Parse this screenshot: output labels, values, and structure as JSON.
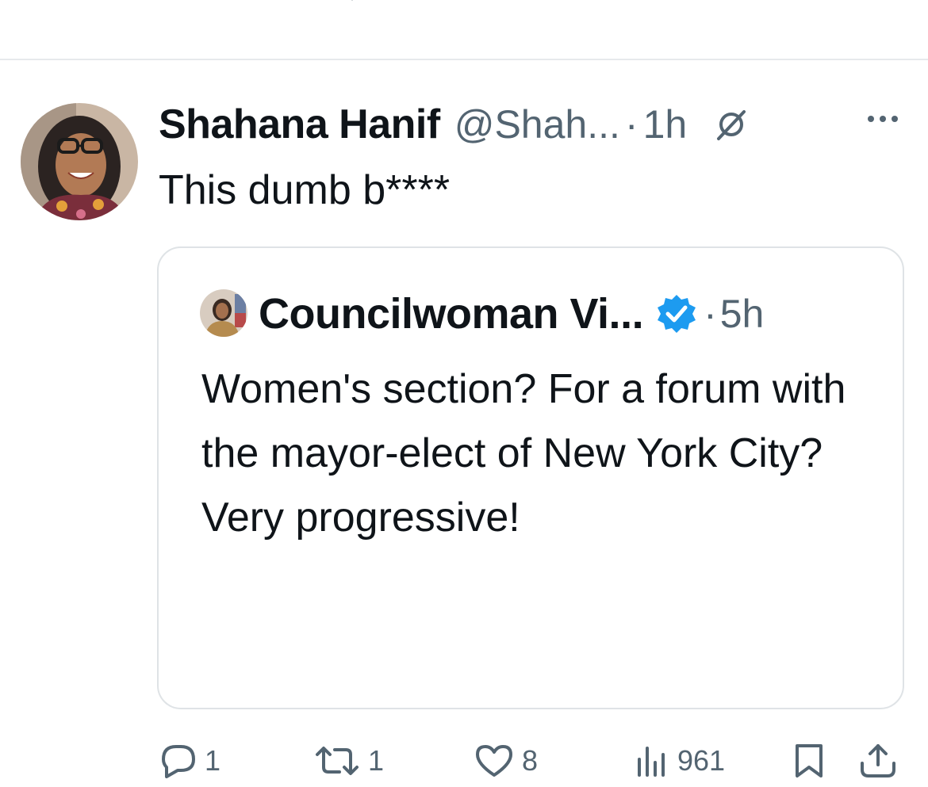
{
  "previous_tweet": {
    "note": ""
  },
  "tweet": {
    "author_name": "Shahana Hanif",
    "handle": "@Shah...",
    "separator": "·",
    "time": "1h",
    "text": "This dumb b****",
    "quote": {
      "author_name": "Councilwoman Vi...",
      "separator": "·",
      "time": "5h",
      "text": "Women's section? For a forum with the mayor-elect of New York City? Very progressive!"
    },
    "actions": {
      "replies": "1",
      "reposts": "1",
      "likes": "8",
      "views": "961"
    }
  },
  "colors": {
    "secondary_text": "#536471",
    "primary_text": "#0f1419",
    "verified_blue": "#1d9bf0",
    "border": "#dfe3e6"
  },
  "icons": {
    "grok": "slashed-circle-icon",
    "more": "more-dots-icon",
    "verified": "verified-badge-icon",
    "reply": "reply-icon",
    "repost": "repost-icon",
    "like": "heart-icon",
    "views": "views-chart-icon",
    "bookmark": "bookmark-icon",
    "share": "share-icon"
  }
}
